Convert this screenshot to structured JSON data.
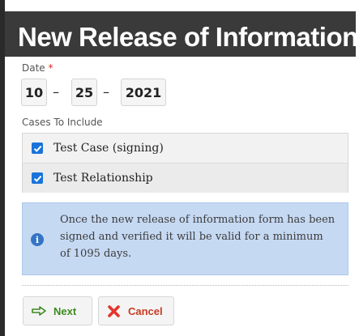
{
  "dialog": {
    "title": "New Release of Information"
  },
  "date_field": {
    "label": "Date",
    "required_marker": "*",
    "month": "10",
    "day": "25",
    "year": "2021",
    "separator": "–"
  },
  "cases": {
    "label": "Cases To Include",
    "items": [
      {
        "label": "Test Case (signing)",
        "checked": true
      },
      {
        "label": "Test Relationship",
        "checked": true
      }
    ]
  },
  "info_notice": {
    "icon": "info-icon",
    "text": "Once the new release of information form has been signed and verified it will be valid for a minimum of 1095 days."
  },
  "actions": {
    "next_label": "Next",
    "next_icon": "arrow-right-icon",
    "cancel_label": "Cancel",
    "cancel_icon": "x-icon"
  },
  "colors": {
    "title_bar": "#3a3a3a",
    "info_background": "#c6d9f3",
    "checkbox": "#1a73d9",
    "next_text": "#3d8a20",
    "cancel_text": "#c63b22",
    "required": "#d9261c"
  }
}
